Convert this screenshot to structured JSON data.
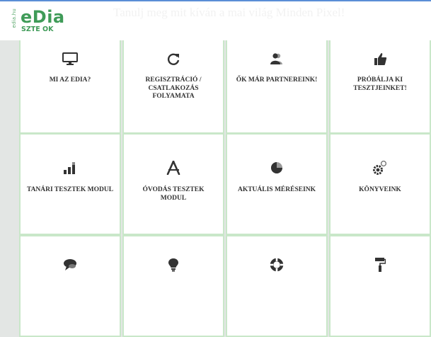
{
  "header": {
    "logo_side_text": "edia.hu",
    "logo_name": "eDia",
    "logo_sub": "SZTE OK",
    "tagline": "Tanulj meg mit kíván a mai világ Minden Pixel!",
    "accent_color": "#3f9b58"
  },
  "tiles": [
    {
      "label": "MI AZ EDIA?",
      "icon": "monitor-icon"
    },
    {
      "label": "REGISZTRÁCIÓ / CSATLAKOZÁS FOLYAMATA",
      "icon": "refresh-icon"
    },
    {
      "label": "ŐK MÁR PARTNEREINK!",
      "icon": "users-icon"
    },
    {
      "label": "PRÓBÁLJA KI TESZTJEINKET!",
      "icon": "thumbs-up-icon"
    },
    {
      "label": "TANÁRI TESZTEK MODUL",
      "icon": "signal-bars-icon"
    },
    {
      "label": "ÓVODÁS TESZTEK MODUL",
      "icon": "drafting-compass-icon"
    },
    {
      "label": "AKTUÁLIS MÉRÉSEINK",
      "icon": "pie-chart-icon"
    },
    {
      "label": "KÖNYVEINK",
      "icon": "gears-icon"
    },
    {
      "label": "",
      "icon": "speech-bubble-icon"
    },
    {
      "label": "",
      "icon": "lightbulb-icon"
    },
    {
      "label": "",
      "icon": "lifebuoy-icon"
    },
    {
      "label": "",
      "icon": "paint-roller-icon"
    }
  ]
}
